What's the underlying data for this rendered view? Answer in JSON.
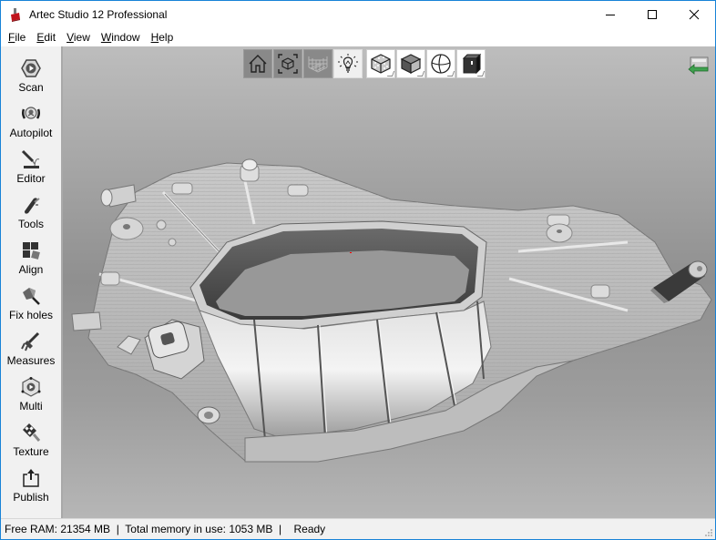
{
  "window": {
    "title": "Artec Studio 12 Professional",
    "controls": {
      "minimize": "minimize",
      "maximize": "maximize",
      "close": "close"
    }
  },
  "menu": [
    {
      "label": "File",
      "accel": "F",
      "rest": "ile"
    },
    {
      "label": "Edit",
      "accel": "E",
      "rest": "dit"
    },
    {
      "label": "View",
      "accel": "V",
      "rest": "iew"
    },
    {
      "label": "Window",
      "accel": "W",
      "rest": "indow"
    },
    {
      "label": "Help",
      "accel": "H",
      "rest": "elp"
    }
  ],
  "sidebar": {
    "tools": [
      {
        "label": "Scan",
        "icon": "scan-icon"
      },
      {
        "label": "Autopilot",
        "icon": "autopilot-icon"
      },
      {
        "label": "Editor",
        "icon": "editor-icon"
      },
      {
        "label": "Tools",
        "icon": "tools-icon"
      },
      {
        "label": "Align",
        "icon": "align-icon"
      },
      {
        "label": "Fix holes",
        "icon": "fix-holes-icon"
      },
      {
        "label": "Measures",
        "icon": "measures-icon"
      },
      {
        "label": "Multi",
        "icon": "multi-icon"
      },
      {
        "label": "Texture",
        "icon": "texture-icon"
      },
      {
        "label": "Publish",
        "icon": "publish-icon"
      }
    ]
  },
  "viewport_toolbar": [
    {
      "name": "home-view",
      "icon": "home-icon",
      "state": "dark"
    },
    {
      "name": "fit-to-view",
      "icon": "fit-cube-icon",
      "state": "dark"
    },
    {
      "name": "grid-toggle",
      "icon": "grid-icon",
      "state": "dark"
    },
    {
      "name": "lighting-toggle",
      "icon": "lightbulb-icon",
      "state": "light"
    },
    {
      "name": "render-texture",
      "icon": "textured-cube-icon",
      "state": "white"
    },
    {
      "name": "render-solid",
      "icon": "solid-cube-icon",
      "state": "white"
    },
    {
      "name": "render-wireframe",
      "icon": "sphere-wireframe-icon",
      "state": "white"
    },
    {
      "name": "render-mode",
      "icon": "dark-cube-icon",
      "state": "white"
    }
  ],
  "back_button": {
    "icon": "back-arrow-icon"
  },
  "status": {
    "free_ram": "Free RAM: 21354 MB",
    "total_memory": "Total memory in use: 1053 MB",
    "state": "Ready",
    "text": "Free RAM: 21354 MB  |  Total memory in use: 1053 MB  |    Ready"
  },
  "colors": {
    "window_border": "#1883d7",
    "sidebar_bg": "#f1f1f1",
    "viewport_top": "#bdbdbd",
    "viewport_mid": "#8f8f8f",
    "viewport_bottom": "#b6b6b6",
    "model_surface": "#c4c4c4"
  }
}
